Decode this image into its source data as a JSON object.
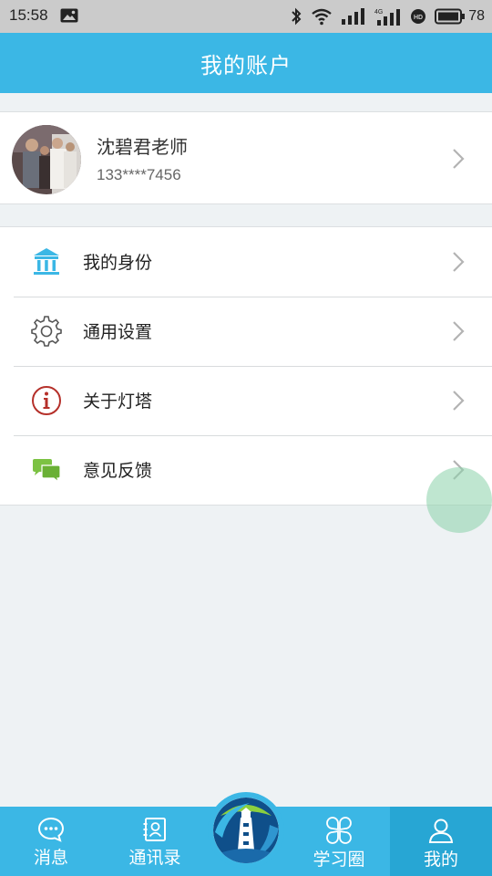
{
  "status_bar": {
    "time": "15:58",
    "battery": "78",
    "network_label": "4G",
    "hd_label": "HD",
    "icons": [
      "photo-icon",
      "bluetooth-icon",
      "wifi-icon",
      "signal-icon",
      "signal-4g-icon",
      "hd-icon",
      "battery-icon"
    ]
  },
  "header": {
    "title": "我的账户"
  },
  "profile": {
    "name": "沈碧君老师",
    "phone": "133****7456"
  },
  "menu": {
    "items": [
      {
        "label": "我的身份",
        "icon": "identity-bank-icon"
      },
      {
        "label": "通用设置",
        "icon": "gear-icon"
      },
      {
        "label": "关于灯塔",
        "icon": "info-icon"
      },
      {
        "label": "意见反馈",
        "icon": "feedback-chat-icon"
      }
    ]
  },
  "bottom_nav": {
    "tabs": [
      {
        "label": "消息",
        "icon": "message-icon"
      },
      {
        "label": "通讯录",
        "icon": "contacts-icon"
      },
      {
        "label": "学习圈",
        "icon": "study-circle-icon"
      },
      {
        "label": "我的",
        "icon": "profile-icon",
        "active": true
      }
    ],
    "center_icon": "lighthouse-logo-icon"
  },
  "colors": {
    "primary": "#3bb7e5",
    "active_tab": "#27a6d4",
    "background": "#eef2f4",
    "info_red": "#b5302a",
    "feedback_green": "#7cc243",
    "identity_blue": "#3bb7e5"
  }
}
